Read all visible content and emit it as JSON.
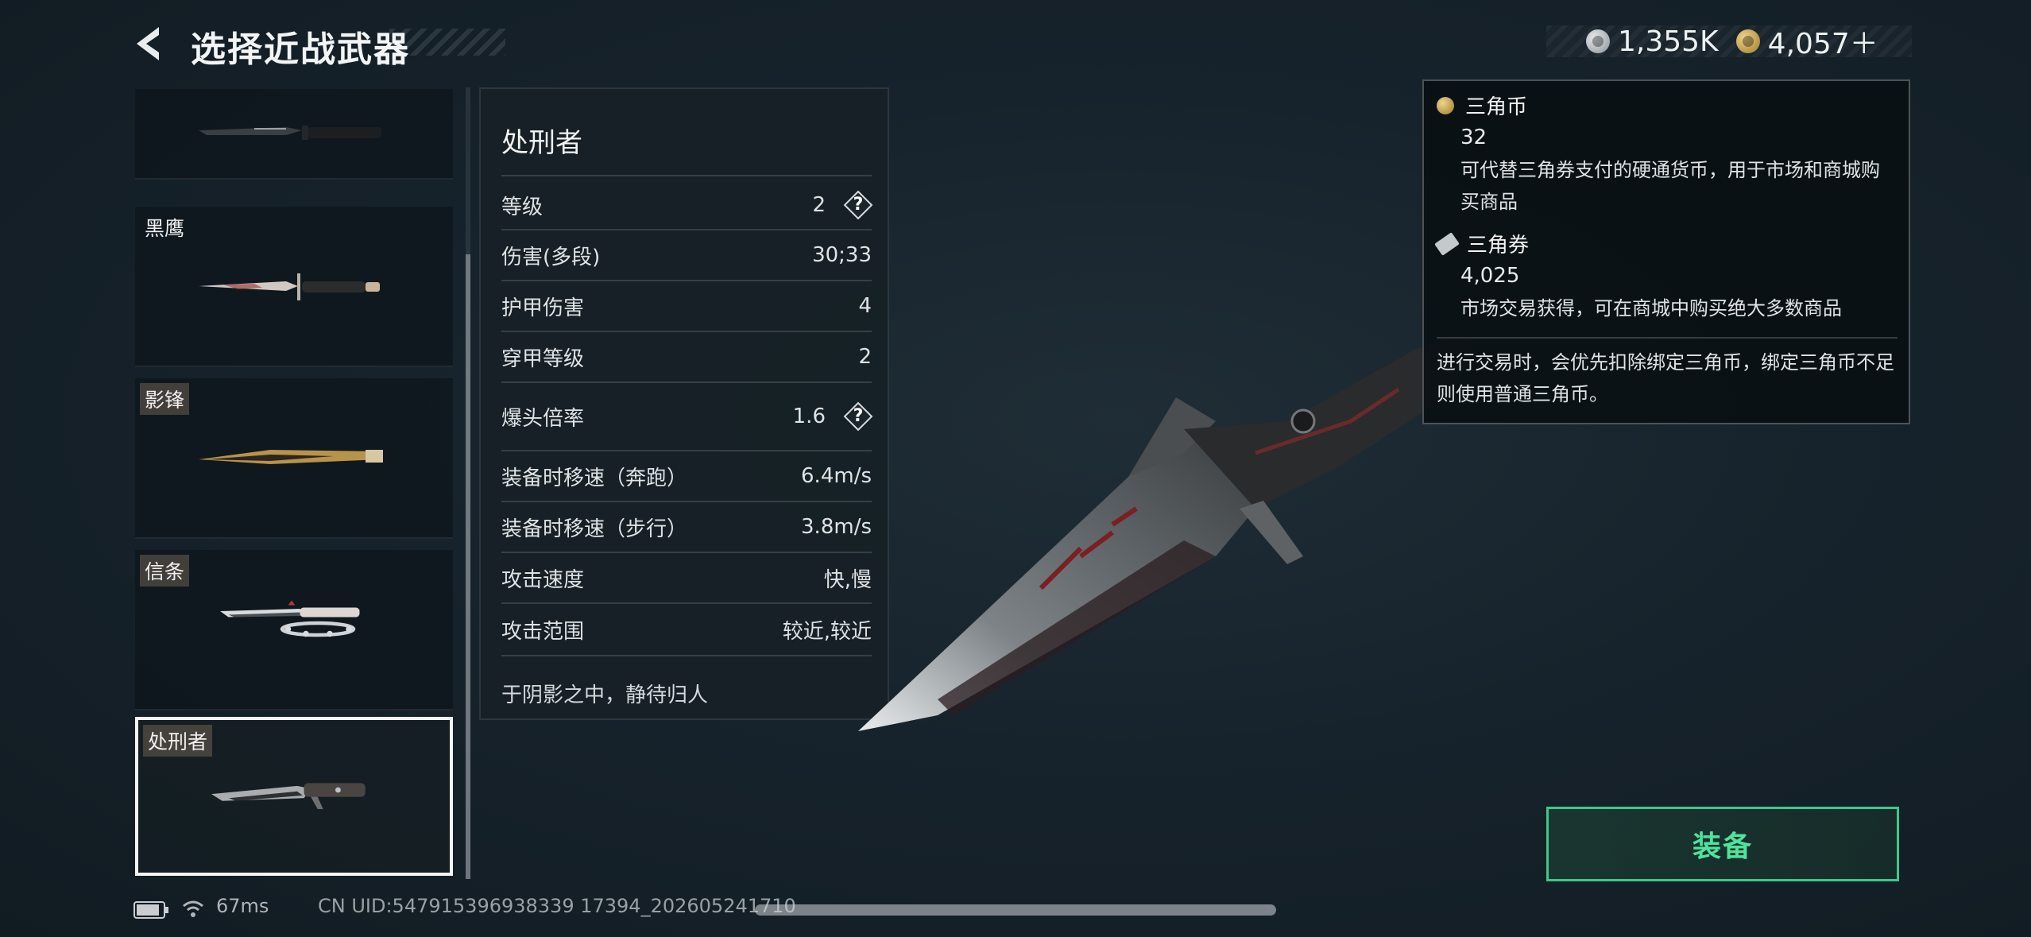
{
  "header": {
    "title": "选择近战武器"
  },
  "currency": {
    "silver_value": "1,355K",
    "gold_value": "4,057＋"
  },
  "weapons": [
    {
      "name": ""
    },
    {
      "name": "黑鹰"
    },
    {
      "name": "影锋"
    },
    {
      "name": "信条"
    },
    {
      "name": "处刑者"
    }
  ],
  "selected_weapon": {
    "name": "处刑者",
    "stats": [
      {
        "label": "等级",
        "value": "2"
      },
      {
        "label": "伤害(多段)",
        "value": "30;33"
      },
      {
        "label": "护甲伤害",
        "value": "4"
      },
      {
        "label": "穿甲等级",
        "value": "2"
      },
      {
        "label": "爆头倍率",
        "value": "1.6"
      },
      {
        "label": "装备时移速（奔跑）",
        "value": "6.4m/s"
      },
      {
        "label": "装备时移速（步行）",
        "value": "3.8m/s"
      },
      {
        "label": "攻击速度",
        "value": "快,慢"
      },
      {
        "label": "攻击范围",
        "value": "较近,较近"
      }
    ],
    "help_symbol": "?",
    "quote": "于阴影之中，静待归人"
  },
  "tooltip": {
    "coin_title": "三角币",
    "coin_amount": "32",
    "coin_desc": "可代替三角券支付的硬通货币，用于市场和商城购买商品",
    "ticket_title": "三角券",
    "ticket_amount": "4,025",
    "ticket_desc": "市场交易获得，可在商城中购买绝大多数商品",
    "note": "进行交易时，会优先扣除绑定三角币，绑定三角币不足则使用普通三角币。"
  },
  "equip_button": {
    "label": "装备"
  },
  "status": {
    "ping": "67ms",
    "uid": "CN UID:547915396938339 17394_202605241710"
  },
  "colors": {
    "accent_green": "#4fe39b",
    "background": "#17232c"
  }
}
